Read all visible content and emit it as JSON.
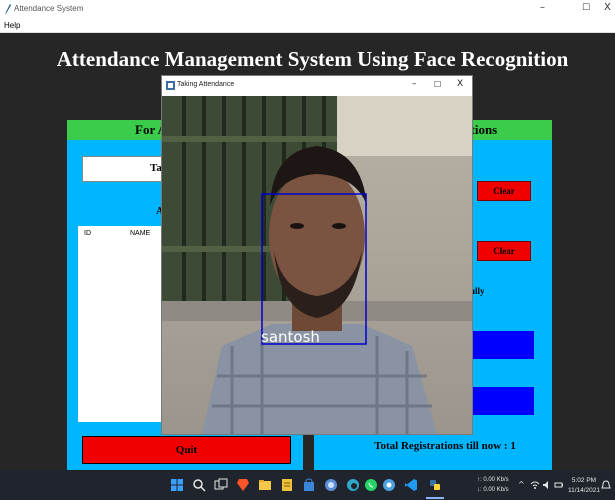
{
  "window": {
    "title": "Attendance System",
    "minimize_glyph": "–",
    "maximize_glyph": "☐",
    "close_glyph": "X"
  },
  "menu": {
    "help_label": "Help"
  },
  "main_title": "Attendance Management System Using Face Recognition",
  "left_panel": {
    "header_visible": "For A",
    "take_button_visible": "Ta",
    "attendance_label_visible": "A",
    "table_columns": [
      "ID",
      "NAME"
    ],
    "quit_label": "Quit"
  },
  "right_panel": {
    "header_visible": "ations",
    "clear_labels": [
      "Clear",
      "Clear"
    ],
    "message_visible": "ully",
    "registrations_text": "Total Registrations till now  : 1"
  },
  "popup": {
    "title": "Taking Attendance",
    "minimize_glyph": "–",
    "maximize_glyph": "☐",
    "close_glyph": "X",
    "recognized_name": "santosh",
    "face_box_color": "#0000cc"
  },
  "taskbar": {
    "net_up": "↑: 0.00 Kb/s",
    "net_down": "↓: 0.00 Kb/s",
    "tray_caret": "^",
    "clock_time": "5:02 PM",
    "clock_date": "11/14/2021",
    "icons": [
      "windows-start-icon",
      "search-icon",
      "task-view-icon",
      "brave-browser-icon",
      "file-explorer-icon",
      "notes-icon",
      "store-icon",
      "copilot-icon",
      "whatsapp-icon",
      "browser-icon",
      "vscode-icon",
      "python-icon"
    ]
  },
  "colors": {
    "desktop_bg": "#262626",
    "panel_bg": "#00b7ff",
    "panel_header": "#3ccc4b",
    "danger": "#f00000",
    "action_blue": "#0000ff"
  }
}
